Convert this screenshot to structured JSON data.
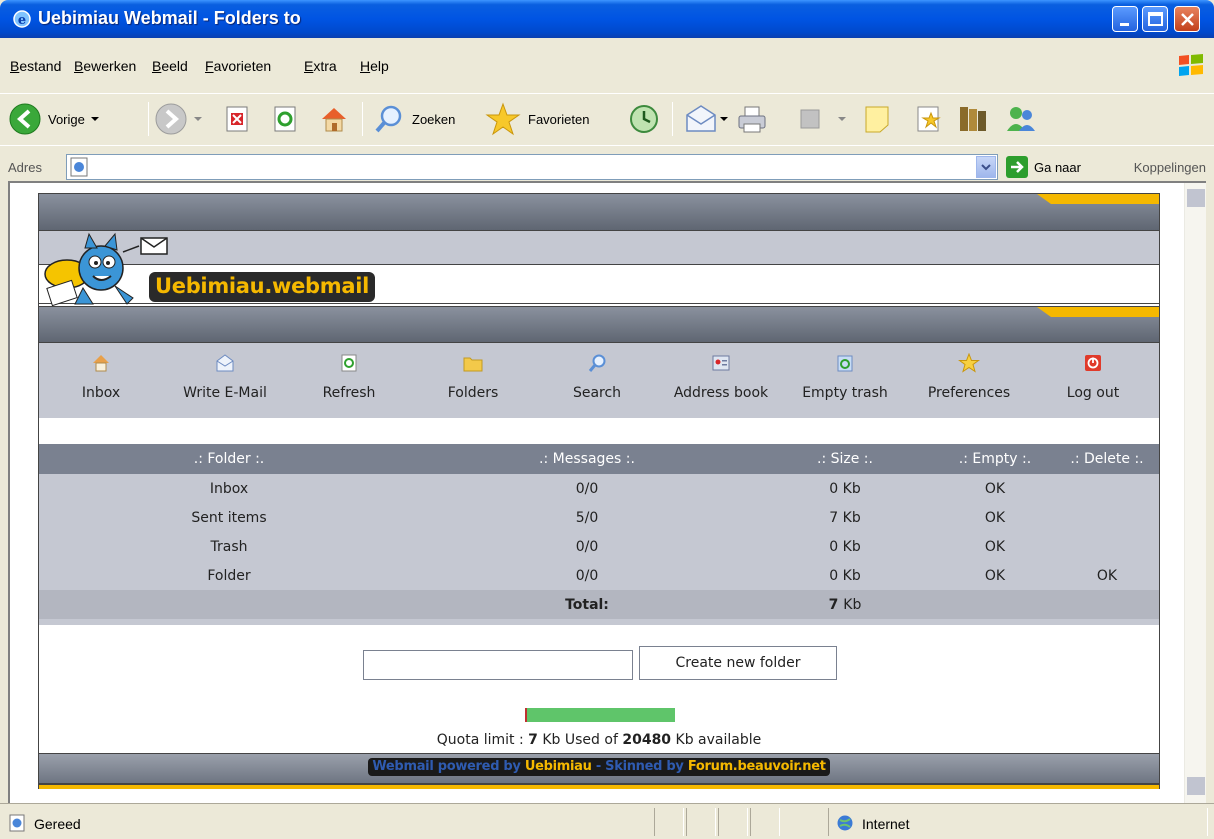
{
  "window": {
    "title": "Uebimiau Webmail - Folders to"
  },
  "menu": [
    "Bestand",
    "Bewerken",
    "Beeld",
    "Favorieten",
    "Extra",
    "Help"
  ],
  "toolbar": {
    "back_label": "Vorige",
    "search_label": "Zoeken",
    "favorites_label": "Favorieten"
  },
  "address": {
    "label": "Adres",
    "value": "",
    "go_label": "Ga naar",
    "links_label": "Koppelingen"
  },
  "app": {
    "logo_text": "Uebimiau.webmail",
    "nav": [
      {
        "label": "Inbox",
        "icon": "home-icon"
      },
      {
        "label": "Write E-Mail",
        "icon": "envelope-write-icon"
      },
      {
        "label": "Refresh",
        "icon": "refresh-icon"
      },
      {
        "label": "Folders",
        "icon": "folder-icon"
      },
      {
        "label": "Search",
        "icon": "magnifier-icon"
      },
      {
        "label": "Address book",
        "icon": "address-book-icon"
      },
      {
        "label": "Empty trash",
        "icon": "empty-trash-icon"
      },
      {
        "label": "Preferences",
        "icon": "star-icon"
      },
      {
        "label": "Log out",
        "icon": "power-icon"
      }
    ],
    "table": {
      "headers": [
        ".: Folder :.",
        ".: Messages :.",
        ".: Size :.",
        ".: Empty :.",
        ".: Delete :."
      ],
      "rows": [
        {
          "folder": "Inbox",
          "messages": "0/0",
          "size": "0 Kb",
          "empty": "OK",
          "delete": ""
        },
        {
          "folder": "Sent items",
          "messages": "5/0",
          "size": "7 Kb",
          "empty": "OK",
          "delete": ""
        },
        {
          "folder": "Trash",
          "messages": "0/0",
          "size": "0 Kb",
          "empty": "OK",
          "delete": ""
        },
        {
          "folder": "Folder",
          "messages": "0/0",
          "size": "0 Kb",
          "empty": "OK",
          "delete": "OK"
        }
      ],
      "total_label": "Total:",
      "total_value": "7",
      "total_unit": "Kb"
    },
    "new_folder": {
      "value": "",
      "button_label": "Create new folder"
    },
    "quota": {
      "prefix": "Quota limit :",
      "used": "7",
      "mid": "Kb Used of",
      "total": "20480",
      "suffix": "Kb available",
      "used_fraction": 0.00034
    },
    "footer": {
      "part1": "Webmail powered by",
      "part2": "Uebimiau",
      "part3": "- Skinned by",
      "part4": "Forum.beauvoir.net"
    }
  },
  "status": {
    "text": "Gereed",
    "zone": "Internet"
  },
  "colors": {
    "titlebar": "#0054e3",
    "nav_bg": "#c5c8d2",
    "header_bg": "#7a8190",
    "accent_yellow": "#f5b800",
    "quota_green": "#5fc56a"
  }
}
